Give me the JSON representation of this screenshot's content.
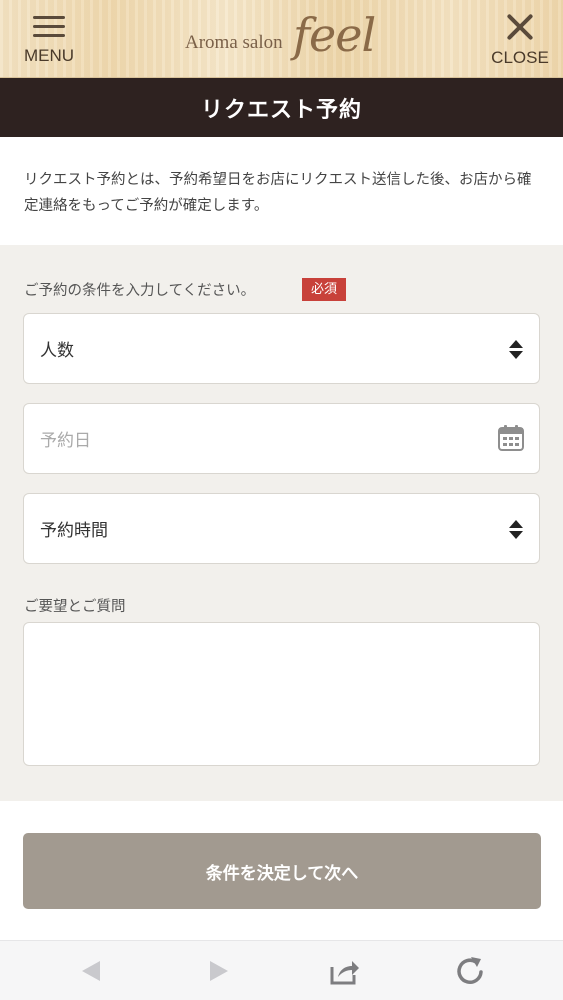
{
  "header": {
    "menu_label": "MENU",
    "close_label": "CLOSE",
    "logo_small": "Aroma salon",
    "logo_big": "feel"
  },
  "title": "リクエスト予約",
  "intro": "リクエスト予約とは、予約希望日をお店にリクエスト送信した後、お店から確定連絡をもってご予約が確定します。",
  "form": {
    "condition_label": "ご予約の条件を入力してください。",
    "required_badge": "必須",
    "people_select": "人数",
    "date_placeholder": "予約日",
    "time_select": "予約時間",
    "request_label": "ご要望とご質問",
    "request_value": ""
  },
  "submit_label": "条件を決定して次へ",
  "colors": {
    "title_bar": "#2e2220",
    "required": "#c8413a",
    "submit": "#a29a90",
    "form_bg": "#f2f0ec"
  },
  "toolbar": {
    "icons": [
      "back-icon",
      "forward-icon",
      "share-icon",
      "reload-icon"
    ]
  }
}
